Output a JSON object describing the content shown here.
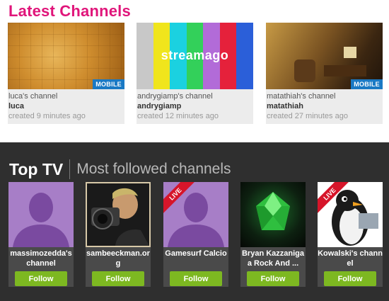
{
  "latest": {
    "title": "Latest Channels",
    "channels": [
      {
        "channel": "luca's channel",
        "user": "luca",
        "created": "created 9 minutes ago",
        "badge": "MOBILE"
      },
      {
        "channel": "andrygiamp's channel",
        "user": "andrygiamp",
        "created": "created 12 minutes ago",
        "overlay": "streamago"
      },
      {
        "channel": "matathiah's channel",
        "user": "matathiah",
        "created": "created 27 minutes ago",
        "badge": "MOBILE"
      }
    ],
    "color_bars": [
      "#c8c8c8",
      "#f0e51c",
      "#1bd1e0",
      "#33d05a",
      "#b26bd8",
      "#e5213b",
      "#2b5fd9"
    ]
  },
  "toptv": {
    "title": "Top TV",
    "subtitle": "Most followed channels",
    "live_label": "LIVE",
    "follow_label": "Follow",
    "channels": [
      {
        "name": "massimozedda's channel"
      },
      {
        "name": "sambeeckman.org"
      },
      {
        "name": "Gamesurf Calcio"
      },
      {
        "name": "Bryan Kazzaniga a Rock And ..."
      },
      {
        "name": "Kowalski's channel"
      }
    ]
  },
  "colors": {
    "brand_pink": "#e0157a",
    "follow_green": "#7db821",
    "mobile_badge_blue": "#1a79c4",
    "live_red": "#d6152a",
    "dark_bg": "#2f2f2f"
  }
}
